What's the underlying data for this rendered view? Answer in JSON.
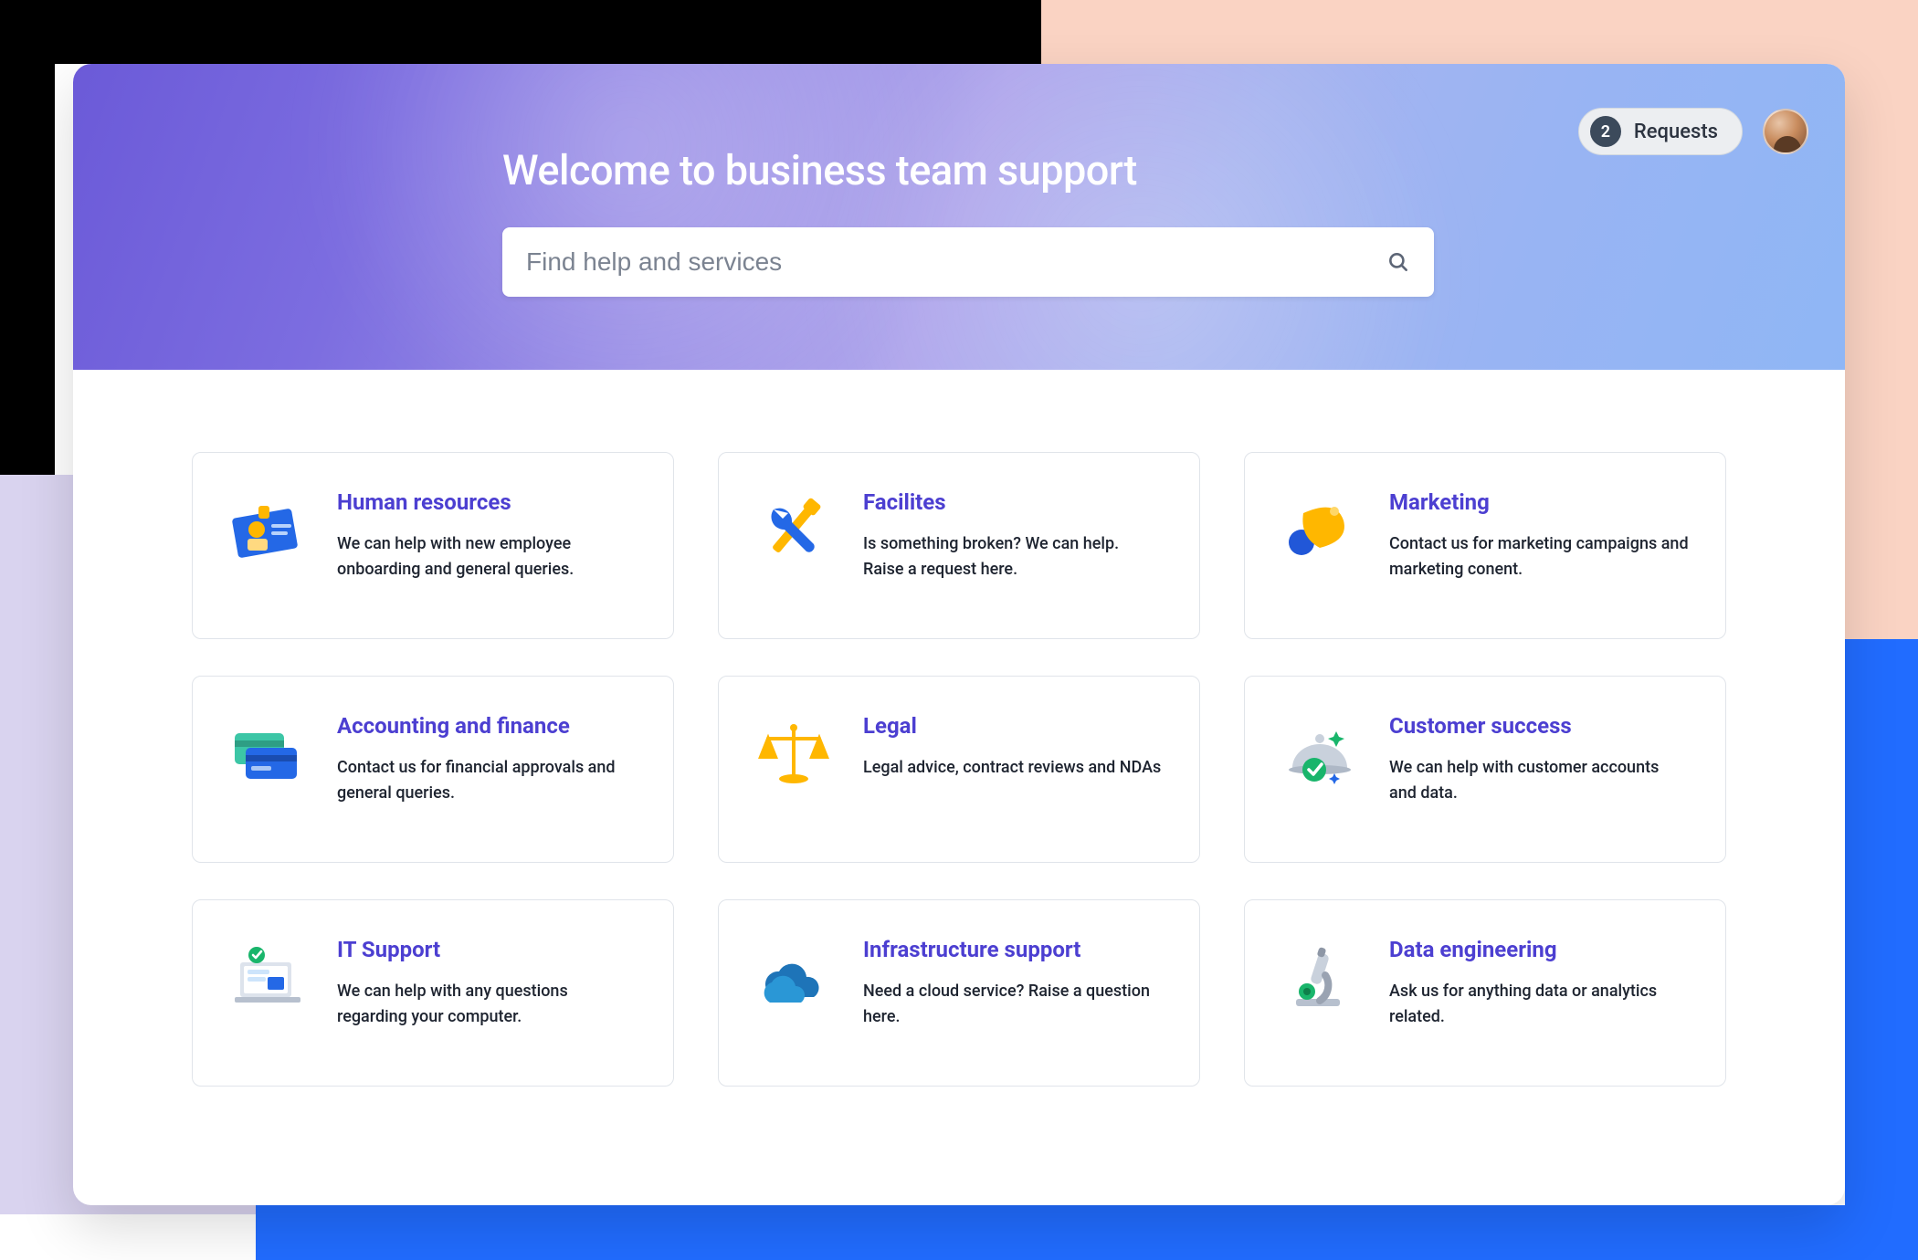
{
  "hero": {
    "title": "Welcome to business team support",
    "search_placeholder": "Find help and services"
  },
  "actions": {
    "requests_count": "2",
    "requests_label": "Requests"
  },
  "cards": [
    {
      "title": "Human resources",
      "desc": "We can help with new employee onboarding and general queries."
    },
    {
      "title": "Facilites",
      "desc": "Is something broken? We can help. Raise a request here."
    },
    {
      "title": "Marketing",
      "desc": "Contact us for marketing campaigns and marketing conent."
    },
    {
      "title": "Accounting and finance",
      "desc": "Contact us for financial approvals and general queries."
    },
    {
      "title": "Legal",
      "desc": "Legal advice, contract reviews and NDAs"
    },
    {
      "title": "Customer success",
      "desc": "We can help with customer accounts and data."
    },
    {
      "title": "IT Support",
      "desc": "We can help with any questions regarding your computer."
    },
    {
      "title": "Infrastructure support",
      "desc": "Need a cloud service? Raise a question here."
    },
    {
      "title": "Data engineering",
      "desc": "Ask us for anything data or analytics related."
    }
  ]
}
